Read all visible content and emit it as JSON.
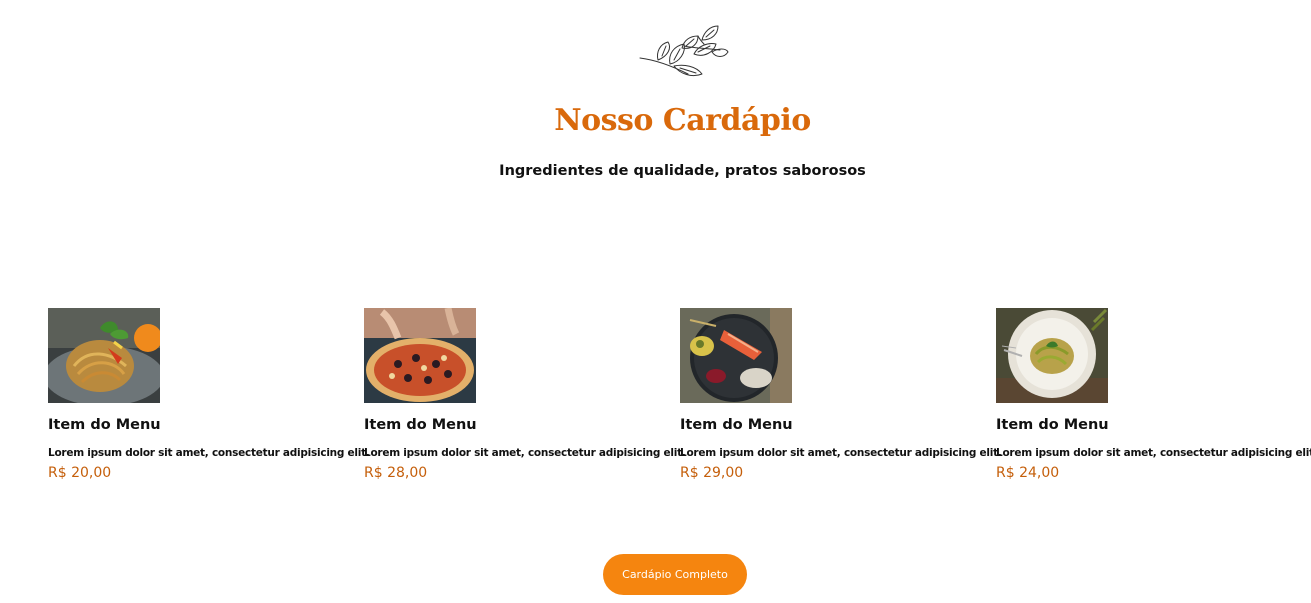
{
  "header": {
    "logo_icon": "herb-branch-icon",
    "title": "Nosso Cardápio",
    "subtitle": "Ingredientes de qualidade, pratos saborosos"
  },
  "menu_items": [
    {
      "image": "spaghetti-plate-photo",
      "title": "Item do Menu",
      "description": "Lorem ipsum dolor sit amet, consectetur adipisicing elit.",
      "price": "R$ 20,00"
    },
    {
      "image": "pizza-photo",
      "title": "Item do Menu",
      "description": "Lorem ipsum dolor sit amet, consectetur adipisicing elit.",
      "price": "R$ 28,00"
    },
    {
      "image": "salmon-plate-photo",
      "title": "Item do Menu",
      "description": "Lorem ipsum dolor sit amet, consectetur adipisicing elit.",
      "price": "R$ 29,00"
    },
    {
      "image": "pasta-pesto-photo",
      "title": "Item do Menu",
      "description": "Lorem ipsum dolor sit amet, consectetur adipisicing elit.",
      "price": "R$ 24,00"
    }
  ],
  "cta": {
    "label": "Cardápio Completo"
  },
  "colors": {
    "title": "#d9690b",
    "price": "#c55f0b",
    "button": "#f5850f"
  }
}
